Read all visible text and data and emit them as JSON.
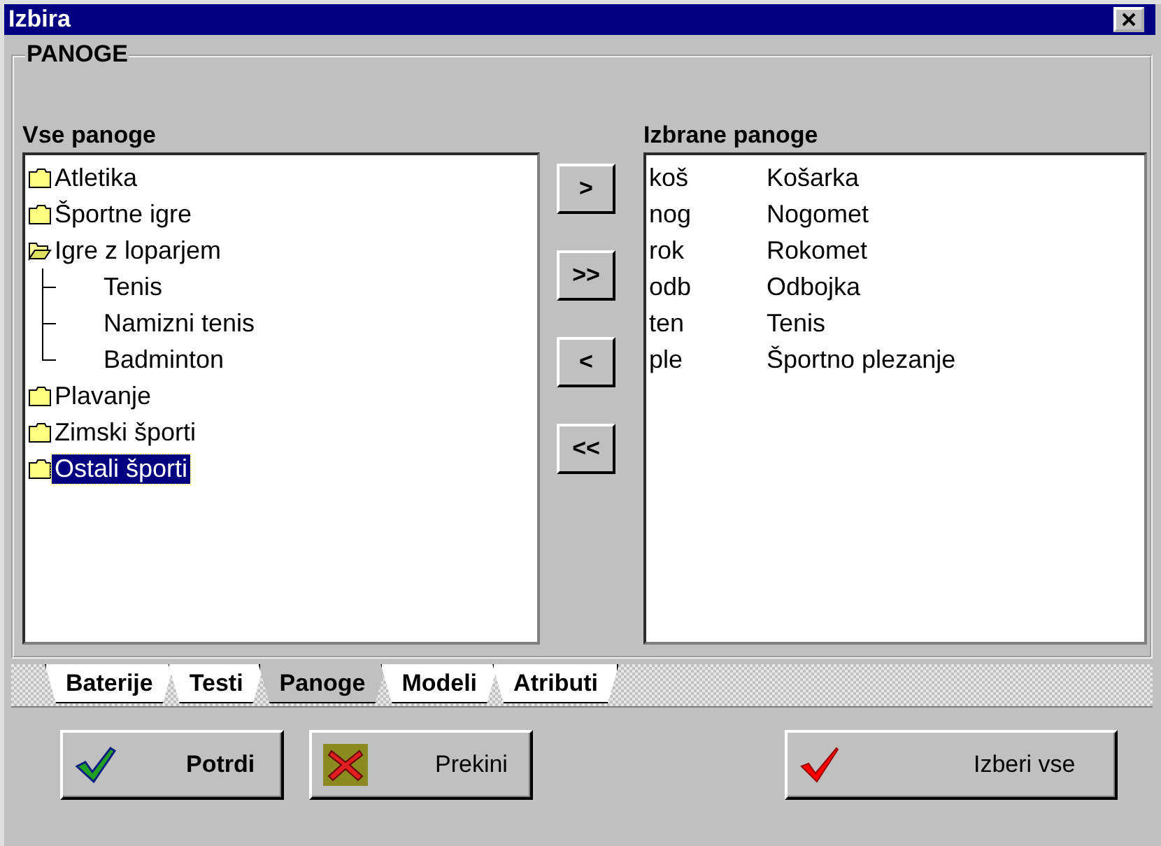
{
  "window": {
    "title": "Izbira"
  },
  "group": {
    "title": "PANOGE"
  },
  "all_list": {
    "label": "Vse panoge",
    "items": [
      {
        "label": "Atletika",
        "expanded": false,
        "selected": false
      },
      {
        "label": "Športne igre",
        "expanded": false,
        "selected": false
      },
      {
        "label": "Igre z loparjem",
        "expanded": true,
        "selected": false,
        "children": [
          {
            "label": "Tenis",
            "selected": false
          },
          {
            "label": "Namizni tenis",
            "selected": false
          },
          {
            "label": "Badminton",
            "selected": false
          }
        ]
      },
      {
        "label": "Plavanje",
        "expanded": false,
        "selected": false
      },
      {
        "label": "Zimski športi",
        "expanded": false,
        "selected": false
      },
      {
        "label": "Ostali športi",
        "expanded": false,
        "selected": true
      }
    ]
  },
  "move_buttons": [
    ">",
    ">>",
    "<",
    "<<"
  ],
  "chosen_list": {
    "label": "Izbrane panoge",
    "rows": [
      {
        "code": "koš",
        "name": "Košarka"
      },
      {
        "code": "nog",
        "name": "Nogomet"
      },
      {
        "code": "rok",
        "name": "Rokomet"
      },
      {
        "code": "odb",
        "name": "Odbojka"
      },
      {
        "code": "ten",
        "name": "Tenis"
      },
      {
        "code": "ple",
        "name": "Športno plezanje"
      }
    ]
  },
  "tabs": [
    {
      "label": "Baterije",
      "selected": false
    },
    {
      "label": "Testi",
      "selected": false
    },
    {
      "label": "Panoge",
      "selected": true
    },
    {
      "label": "Modeli",
      "selected": false
    },
    {
      "label": "Atributi",
      "selected": false
    }
  ],
  "buttons": [
    {
      "label": "Potrdi",
      "kind": "confirm"
    },
    {
      "label": "Prekini",
      "kind": "cancel"
    },
    {
      "label": "Izberi vse",
      "kind": "select_all"
    }
  ]
}
